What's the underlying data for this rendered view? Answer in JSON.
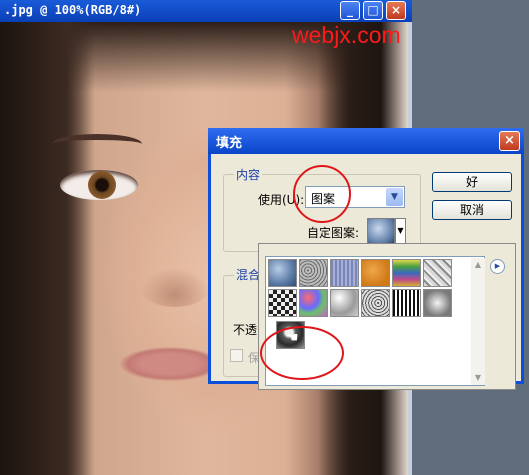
{
  "document": {
    "title": ".jpg @ 100%(RGB/8#)",
    "buttons": {
      "minimize": "_",
      "maximize": "□",
      "close": "×"
    },
    "watermark": "webjx.com"
  },
  "dialog": {
    "title": "填充",
    "close": "×",
    "content_group": {
      "label": "内容",
      "use_label": "使用(U):",
      "use_value": "图案",
      "custom_pattern_label": "自定图案:"
    },
    "blend_group": {
      "label": "混合",
      "opacity_label": "不透",
      "preserve_label": "保"
    },
    "ok_button": "好",
    "cancel_button": "取消"
  },
  "pattern_picker": {
    "menu_icon": "▶",
    "scroll_up": "▲",
    "scroll_down": "▼",
    "patterns": [
      "pattern-blue-bubbles",
      "pattern-gray-noise",
      "pattern-blue-lines",
      "pattern-orange",
      "pattern-rainbow",
      "pattern-gray-diagonal",
      "pattern-checker",
      "pattern-colorful",
      "pattern-white-clouds",
      "pattern-gray-granite",
      "pattern-black-stripes",
      "pattern-gray-stone",
      "pattern-custom-portrait"
    ]
  },
  "colors": {
    "titlebar": "#0a45c8",
    "dialog_bg": "#ece9d8",
    "annotation": "#e0161a",
    "watermark": "#ff1a1a"
  }
}
